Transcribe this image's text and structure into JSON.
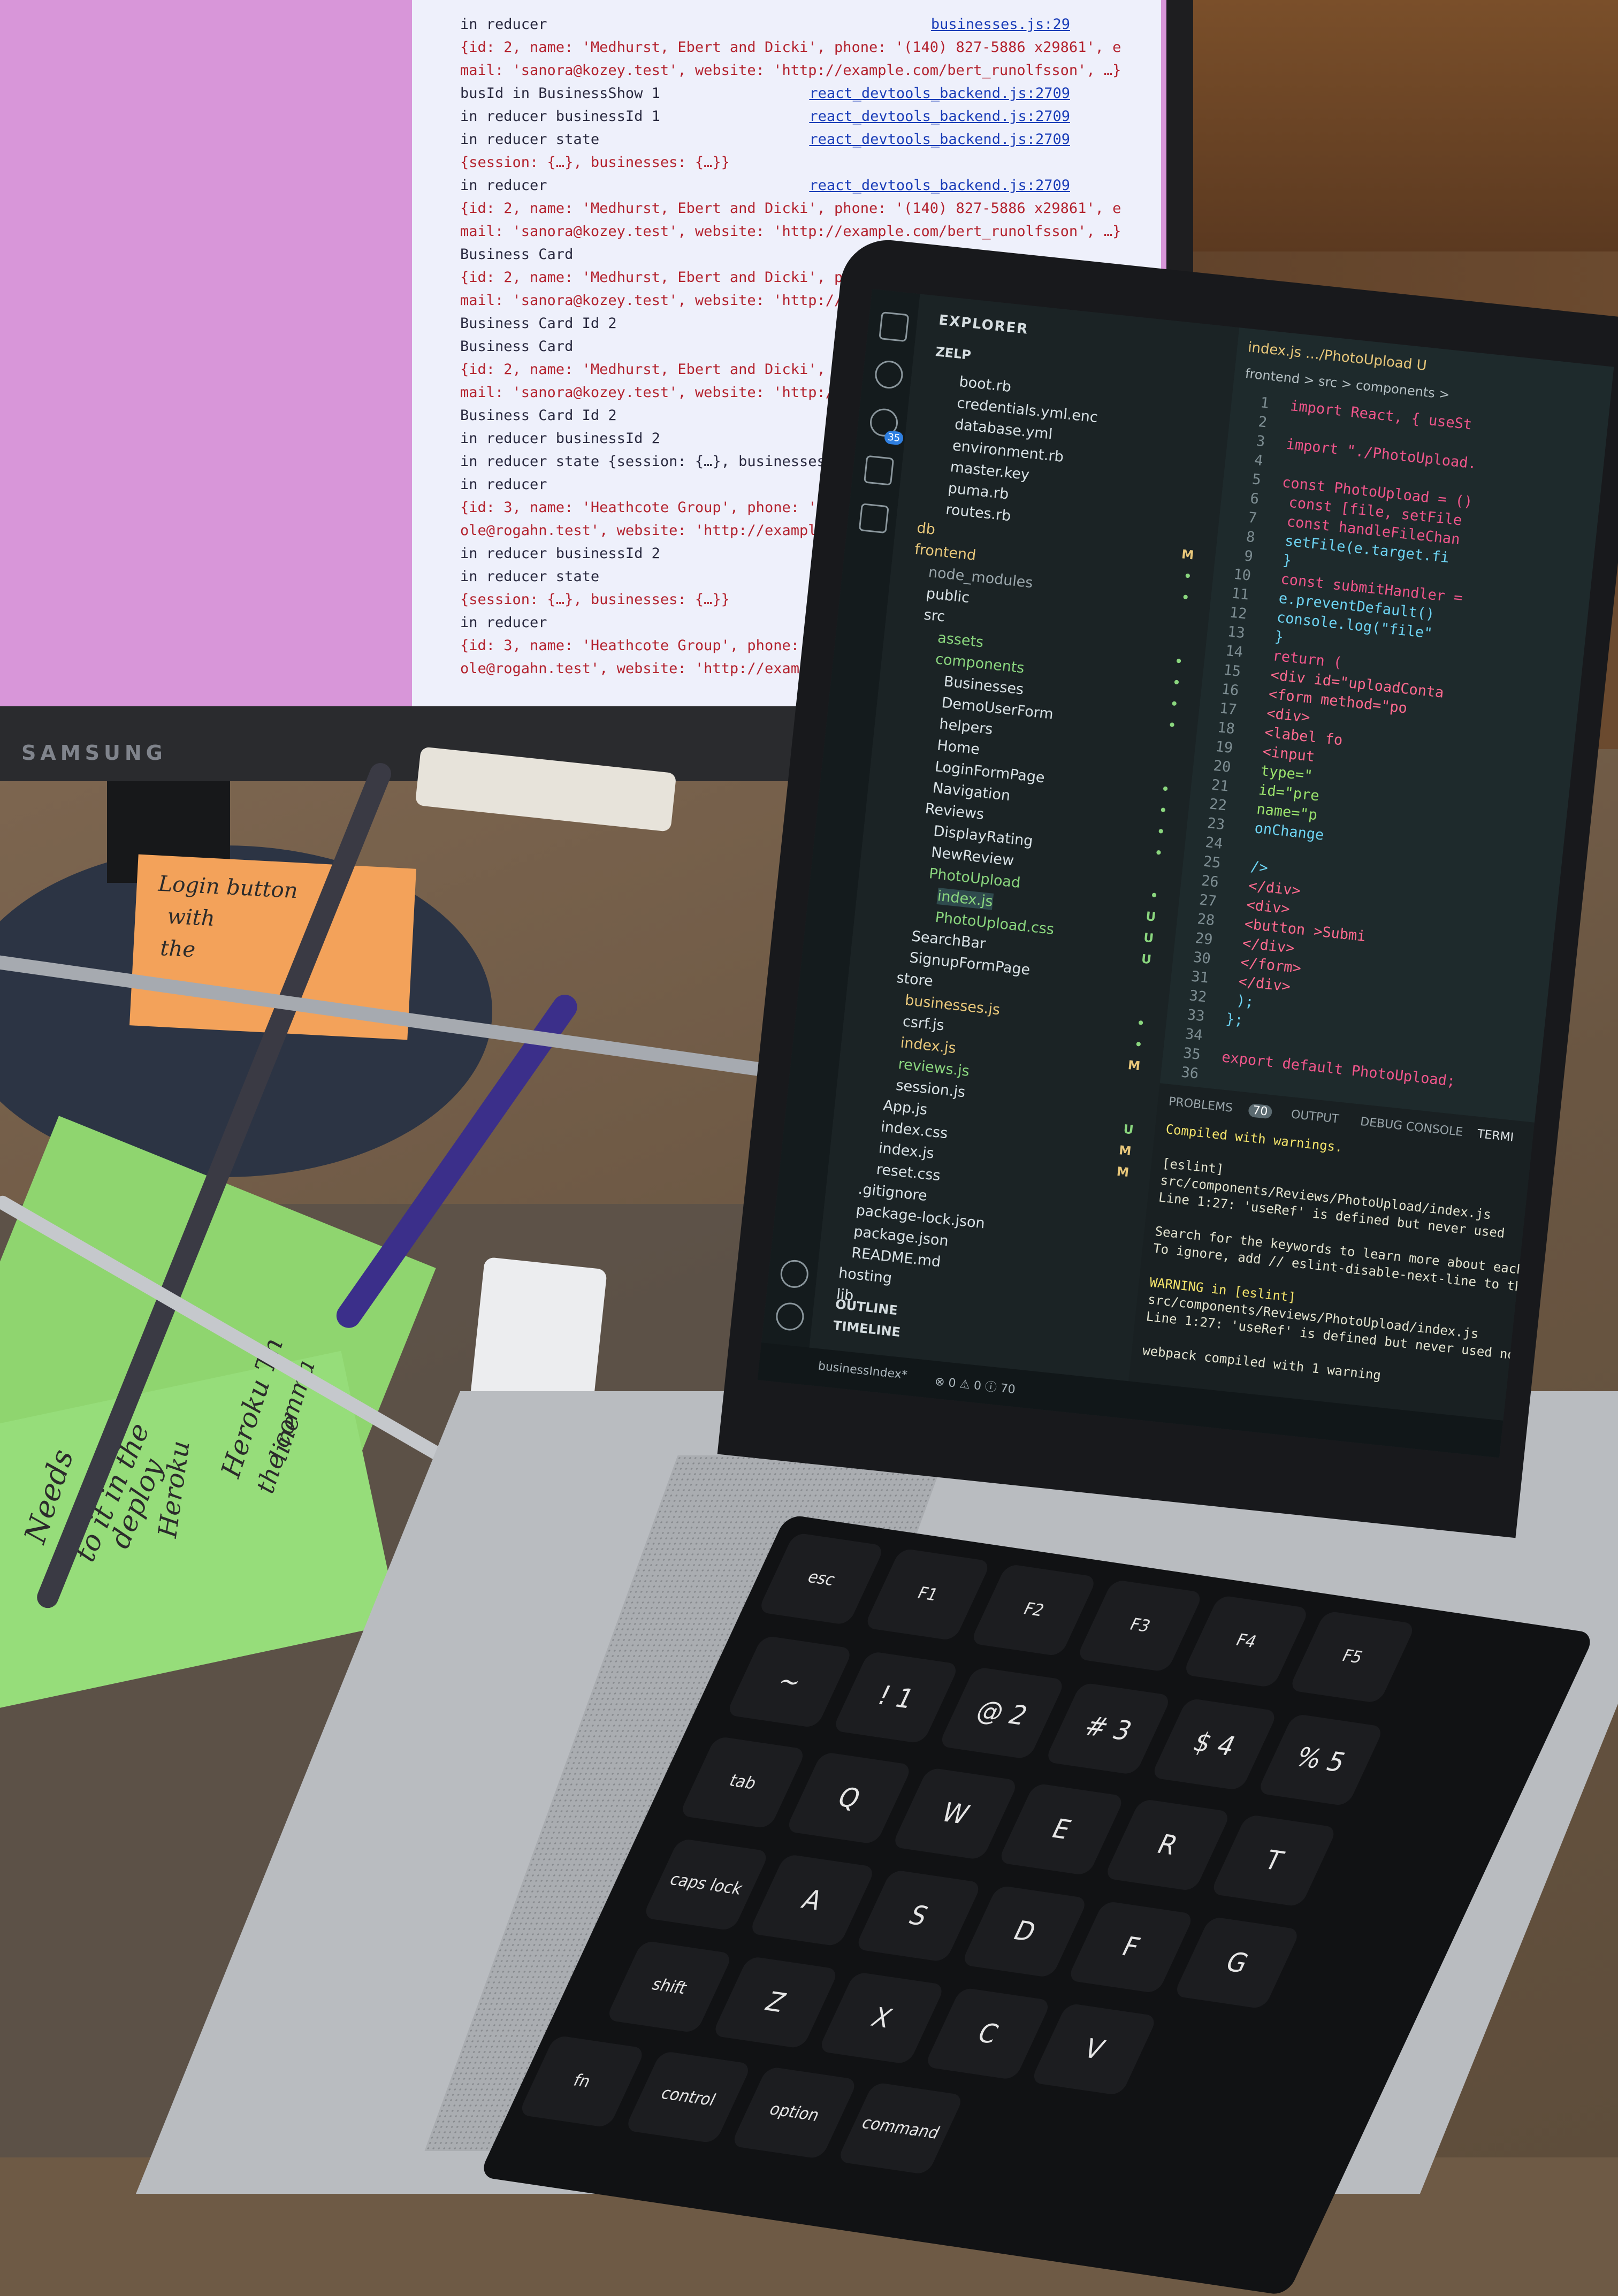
{
  "scene": {
    "monitor_brand": "SAMSUNG",
    "devtools_log": [
      {
        "text": "in reducer",
        "src": "businesses.js:29"
      },
      {
        "text": "{id: 2, name: 'Medhurst, Ebert and Dicki', phone: '(140) 827-5886 x29861', e",
        "src": ""
      },
      {
        "text": "mail: 'sanora@kozey.test', website: 'http://example.com/bert_runolfsson', …}",
        "src": ""
      },
      {
        "text": "busId in BusinessShow 1",
        "src": "react_devtools_backend.js:2709"
      },
      {
        "text": "in reducer businessId 1",
        "src": "react_devtools_backend.js:2709"
      },
      {
        "text": "in reducer state",
        "src": "react_devtools_backend.js:2709"
      },
      {
        "text": "{session: {…}, businesses: {…}}",
        "src": ""
      },
      {
        "text": "in reducer",
        "src": "react_devtools_backend.js:2709"
      },
      {
        "text": "{id: 2, name: 'Medhurst, Ebert and Dicki', phone: '(140) 827-5886 x29861', e",
        "src": ""
      },
      {
        "text": "mail: 'sanora@kozey.test', website: 'http://example.com/bert_runolfsson', …}",
        "src": ""
      },
      {
        "text": "Business Card",
        "src": ""
      },
      {
        "text": "{id: 2, name: 'Medhurst, Ebert and Dicki', phone: '(140)",
        "src": ""
      },
      {
        "text": "mail: 'sanora@kozey.test', website: 'http://example.com/b",
        "src": ""
      },
      {
        "text": "Business Card Id 2",
        "src": ""
      },
      {
        "text": "Business Card",
        "src": "react_devtoo"
      },
      {
        "text": "{id: 2, name: 'Medhurst, Ebert and Dicki', phone: '(140)",
        "src": ""
      },
      {
        "text": "mail: 'sanora@kozey.test', website: 'http://example.com/",
        "src": ""
      },
      {
        "text": "Business Card Id 2",
        "src": "react_devtoo"
      },
      {
        "text": "in reducer businessId 2",
        "src": ""
      },
      {
        "text": "in reducer state {session: {…}, businesses: {…}}",
        "src": ""
      },
      {
        "text": "in reducer",
        "src": ""
      },
      {
        "text": "{id: 3, name: 'Heathcote Group', phone: '771.782.5315 x0",
        "src": ""
      },
      {
        "text": "ole@rogahn.test', website: 'http://example.com/oliver_va",
        "src": ""
      },
      {
        "text": "in reducer businessId 2",
        "src": "react_devto"
      },
      {
        "text": "in reducer state",
        "src": "react_devto"
      },
      {
        "text": "{session: {…}, businesses: {…}}",
        "src": ""
      },
      {
        "text": "in reducer",
        "src": "react_devt"
      },
      {
        "text": "{id: 3, name: 'Heathcote Group', phone: '771.782.5315",
        "src": ""
      },
      {
        "text": "ole@rogahn.test', website: 'http://example.com/oliver_v",
        "src": ""
      }
    ],
    "sticky_orange_text": [
      "Login button",
      "with",
      "the",
      "..."
    ],
    "sticky_green_text": [
      "Needs",
      "to it in the",
      "deploy",
      "Heroku",
      "Heroku Th",
      "the comma",
      "line"
    ]
  },
  "vscode": {
    "explorer_title": "EXPLORER",
    "workspace": "ZELP",
    "tab_title": "index.js …/PhotoUpload U",
    "breadcrumb": "frontend > src > components >",
    "problem_count": "35",
    "tree": [
      {
        "label": "boot.rb",
        "badge": "",
        "color": "#d9e2e6"
      },
      {
        "label": "credentials.yml.enc",
        "badge": "",
        "color": "#d9e2e6"
      },
      {
        "label": "database.yml",
        "badge": "",
        "color": "#d9e2e6"
      },
      {
        "label": "environment.rb",
        "badge": "",
        "color": "#d9e2e6"
      },
      {
        "label": "master.key",
        "badge": "",
        "color": "#d9e2e6"
      },
      {
        "label": "puma.rb",
        "badge": "",
        "color": "#d9e2e6"
      },
      {
        "label": "routes.rb",
        "badge": "",
        "color": "#d9e2e6"
      },
      {
        "label": "db",
        "badge": "M",
        "color": "#e8c77a"
      },
      {
        "label": "frontend",
        "badge": "•",
        "color": "#e8c77a"
      },
      {
        "label": "node_modules",
        "badge": "•",
        "color": "#9aa6ab"
      },
      {
        "label": "public",
        "badge": "",
        "color": "#d9e2e6"
      },
      {
        "label": "src",
        "badge": "",
        "color": "#d9e2e6"
      },
      {
        "label": "assets",
        "badge": "•",
        "color": "#8ad67e"
      },
      {
        "label": "components",
        "badge": "•",
        "color": "#8ad67e"
      },
      {
        "label": "Businesses",
        "badge": "•",
        "color": "#d9e2e6"
      },
      {
        "label": "DemoUserForm",
        "badge": "•",
        "color": "#d9e2e6"
      },
      {
        "label": "helpers",
        "badge": "",
        "color": "#d9e2e6"
      },
      {
        "label": "Home",
        "badge": "",
        "color": "#d9e2e6"
      },
      {
        "label": "LoginFormPage",
        "badge": "•",
        "color": "#d9e2e6"
      },
      {
        "label": "Navigation",
        "badge": "•",
        "color": "#d9e2e6"
      },
      {
        "label": "Reviews",
        "badge": "•",
        "color": "#d9e2e6"
      },
      {
        "label": "DisplayRating",
        "badge": "•",
        "color": "#d9e2e6"
      },
      {
        "label": "NewReview",
        "badge": "",
        "color": "#d9e2e6"
      },
      {
        "label": "PhotoUpload",
        "badge": "•",
        "color": "#8ad67e"
      },
      {
        "label": "index.js",
        "badge": "U",
        "color": "#8ad67e"
      },
      {
        "label": "PhotoUpload.css",
        "badge": "U",
        "color": "#8ad67e"
      },
      {
        "label": "SearchBar",
        "badge": "U",
        "color": "#d9e2e6"
      },
      {
        "label": "SignupFormPage",
        "badge": "",
        "color": "#d9e2e6"
      },
      {
        "label": "store",
        "badge": "",
        "color": "#d9e2e6"
      },
      {
        "label": "businesses.js",
        "badge": "•",
        "color": "#e8c77a"
      },
      {
        "label": "csrf.js",
        "badge": "•",
        "color": "#d9e2e6"
      },
      {
        "label": "index.js",
        "badge": "M",
        "color": "#e8c77a"
      },
      {
        "label": "reviews.js",
        "badge": "",
        "color": "#8ad67e"
      },
      {
        "label": "session.js",
        "badge": "",
        "color": "#d9e2e6"
      },
      {
        "label": "App.js",
        "badge": "U",
        "color": "#d9e2e6"
      },
      {
        "label": "index.css",
        "badge": "M",
        "color": "#d9e2e6"
      },
      {
        "label": "index.js",
        "badge": "M",
        "color": "#d9e2e6"
      },
      {
        "label": "reset.css",
        "badge": "",
        "color": "#d9e2e6"
      },
      {
        "label": ".gitignore",
        "badge": "",
        "color": "#d9e2e6"
      },
      {
        "label": "package-lock.json",
        "badge": "",
        "color": "#d9e2e6"
      },
      {
        "label": "package.json",
        "badge": "",
        "color": "#d9e2e6"
      },
      {
        "label": "README.md",
        "badge": "",
        "color": "#d9e2e6"
      },
      {
        "label": "hosting",
        "badge": "",
        "color": "#d9e2e6"
      },
      {
        "label": "lib",
        "badge": "",
        "color": "#d9e2e6"
      }
    ],
    "outline_label": "OUTLINE",
    "timeline_label": "TIMELINE",
    "code": [
      "import React, { useSt",
      "",
      "import \"./PhotoUpload.",
      "",
      "const PhotoUpload = ()",
      "  const [file, setFile",
      "  const handleFileChan",
      "    setFile(e.target.fi",
      "  }",
      "  const submitHandler =",
      "    e.preventDefault()",
      "    console.log(\"file\"",
      "  }",
      "  return (",
      "    <div id=\"uploadConta",
      "      <form method=\"po",
      "        <div>",
      "          <label fo",
      "          <input",
      "            type=\"",
      "            id=\"pre",
      "            name=\"p",
      "            onChange",
      "",
      "          />",
      "        </div>",
      "        <div>",
      "          <button >Submi",
      "        </div>",
      "      </form>",
      "    </div>",
      "  );",
      "};",
      "",
      "export default PhotoUpload;",
      ""
    ],
    "panel_tabs": [
      "PROBLEMS",
      "OUTPUT",
      "DEBUG CONSOLE",
      "TERMI"
    ],
    "panel_problem_badge": "70",
    "terminal": [
      "Compiled with warnings.",
      "",
      "[eslint]",
      "src/components/Reviews/PhotoUpload/index.js",
      "  Line 1:27:  'useRef' is defined but never used",
      "",
      "Search for the keywords to learn more about each war",
      "To ignore, add // eslint-disable-next-line to the li",
      "",
      "WARNING in [eslint]",
      "src/components/Reviews/PhotoUpload/index.js",
      "  Line 1:27:  'useRef' is defined but never used  no-u",
      "",
      "webpack compiled with 1 warning"
    ],
    "status_branch": "businessIndex*",
    "status_problems": "⊗ 0 ⚠ 0 ⓘ 70"
  },
  "keyboard": {
    "keys": [
      {
        "label": "esc",
        "small": true
      },
      {
        "label": "F1",
        "small": true
      },
      {
        "label": "F2",
        "small": true
      },
      {
        "label": "F3",
        "small": true
      },
      {
        "label": "F4",
        "small": true
      },
      {
        "label": "F5",
        "small": true
      },
      {
        "label": "~",
        "small": false
      },
      {
        "label": "!\n1",
        "small": false
      },
      {
        "label": "@\n2",
        "small": false
      },
      {
        "label": "#\n3",
        "small": false
      },
      {
        "label": "$\n4",
        "small": false
      },
      {
        "label": "%\n5",
        "small": false
      },
      {
        "label": "tab",
        "small": true
      },
      {
        "label": "Q",
        "small": false
      },
      {
        "label": "W",
        "small": false
      },
      {
        "label": "E",
        "small": false
      },
      {
        "label": "R",
        "small": false
      },
      {
        "label": "T",
        "small": false
      },
      {
        "label": "caps lock",
        "small": true
      },
      {
        "label": "A",
        "small": false
      },
      {
        "label": "S",
        "small": false
      },
      {
        "label": "D",
        "small": false
      },
      {
        "label": "F",
        "small": false
      },
      {
        "label": "G",
        "small": false
      },
      {
        "label": "shift",
        "small": true
      },
      {
        "label": "Z",
        "small": false
      },
      {
        "label": "X",
        "small": false
      },
      {
        "label": "C",
        "small": false
      },
      {
        "label": "V",
        "small": false
      },
      {
        "label": "fn",
        "small": true
      },
      {
        "label": "control",
        "small": true
      },
      {
        "label": "option",
        "small": true
      },
      {
        "label": "command",
        "small": true
      }
    ]
  }
}
